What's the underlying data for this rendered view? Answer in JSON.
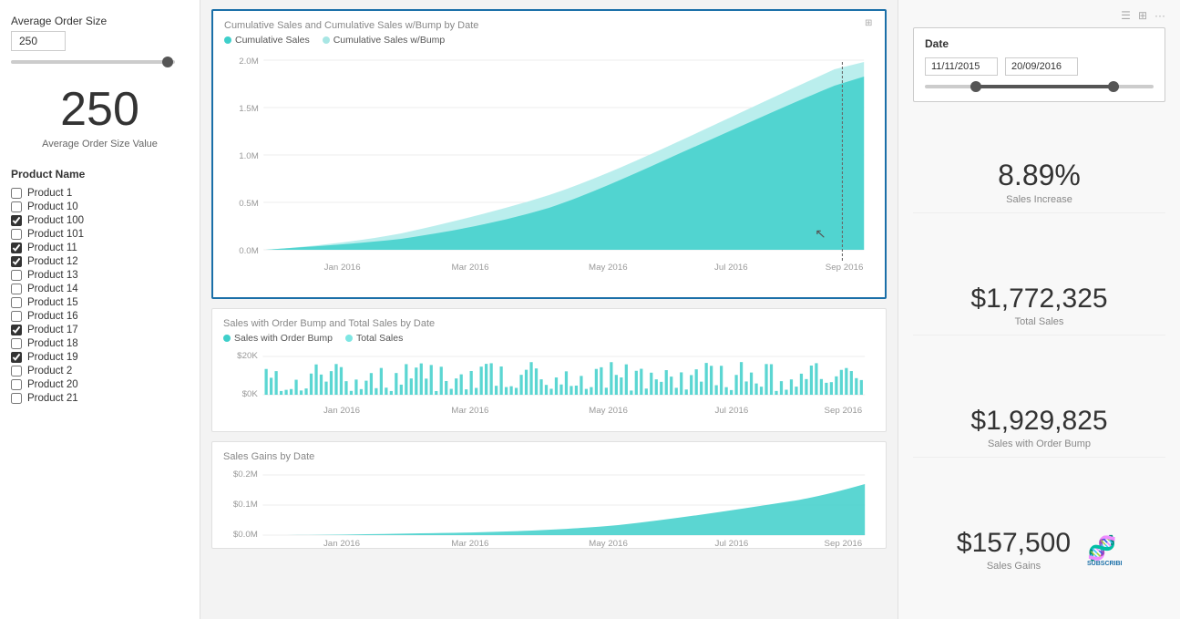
{
  "left": {
    "slider_label": "Average Order Size",
    "slider_value": "250",
    "big_number": "250",
    "big_number_label": "Average Order Size Value",
    "product_list_title": "Product Name",
    "products": [
      {
        "name": "Product 1",
        "checked": false
      },
      {
        "name": "Product 10",
        "checked": false
      },
      {
        "name": "Product 100",
        "checked": true
      },
      {
        "name": "Product 101",
        "checked": false
      },
      {
        "name": "Product 11",
        "checked": true
      },
      {
        "name": "Product 12",
        "checked": true
      },
      {
        "name": "Product 13",
        "checked": false
      },
      {
        "name": "Product 14",
        "checked": false
      },
      {
        "name": "Product 15",
        "checked": false
      },
      {
        "name": "Product 16",
        "checked": false
      },
      {
        "name": "Product 17",
        "checked": true
      },
      {
        "name": "Product 18",
        "checked": false
      },
      {
        "name": "Product 19",
        "checked": true
      },
      {
        "name": "Product 2",
        "checked": false
      },
      {
        "name": "Product 20",
        "checked": false
      },
      {
        "name": "Product 21",
        "checked": false
      }
    ]
  },
  "charts": {
    "cumulative": {
      "title": "Cumulative Sales and Cumulative Sales w/Bump by Date",
      "legend": [
        {
          "label": "Cumulative Sales",
          "color": "#3ecfca"
        },
        {
          "label": "Cumulative Sales w/Bump",
          "color": "#a8e6e4"
        }
      ],
      "y_labels": [
        "2.0M",
        "1.5M",
        "1.0M",
        "0.5M",
        "0.0M"
      ],
      "x_labels": [
        "Jan 2016",
        "Mar 2016",
        "May 2016",
        "Jul 2016",
        "Sep 2016"
      ]
    },
    "bar_chart": {
      "title": "Sales with Order Bump and Total Sales by Date",
      "legend": [
        {
          "label": "Sales with Order Bump",
          "color": "#3ecfca"
        },
        {
          "label": "Total Sales",
          "color": "#7ee6e3"
        }
      ],
      "y_labels": [
        "$20K",
        "$0K"
      ],
      "x_labels": [
        "Jan 2016",
        "Mar 2016",
        "May 2016",
        "Jul 2016",
        "Sep 2016"
      ]
    },
    "gains": {
      "title": "Sales Gains by Date",
      "y_labels": [
        "$0.2M",
        "$0.1M",
        "$0.0M"
      ],
      "x_labels": [
        "Jan 2016",
        "Mar 2016",
        "May 2016",
        "Jul 2016",
        "Sep 2016"
      ]
    }
  },
  "right": {
    "date_title": "Date",
    "date_start": "11/11/2015",
    "date_end": "20/09/2016",
    "kpis": [
      {
        "value": "8.89%",
        "label": "Sales Increase",
        "is_pct": true
      },
      {
        "value": "$1,772,325",
        "label": "Total Sales"
      },
      {
        "value": "$1,929,825",
        "label": "Sales with Order Bump"
      },
      {
        "value": "$157,500",
        "label": "Sales Gains"
      }
    ]
  }
}
